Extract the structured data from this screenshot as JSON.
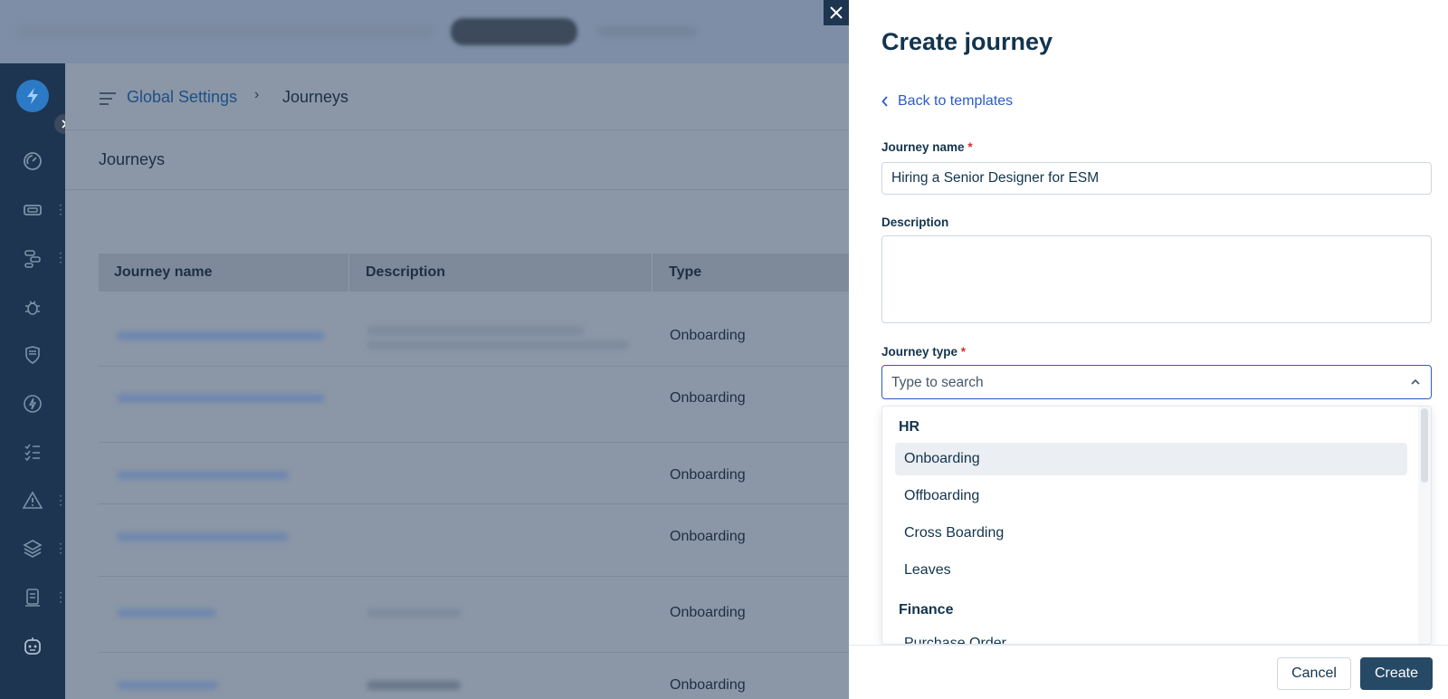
{
  "background": {
    "breadcrumb": {
      "link": "Global Settings",
      "separator": "›",
      "current": "Journeys"
    },
    "page_title": "Journeys",
    "table": {
      "columns": [
        "Journey name",
        "Description",
        "Type"
      ],
      "rows": [
        {
          "type": "Onboarding"
        },
        {
          "type": "Onboarding"
        },
        {
          "type": "Onboarding"
        },
        {
          "type": "Onboarding"
        },
        {
          "type": "Onboarding"
        },
        {
          "type": "Onboarding"
        }
      ]
    },
    "nav_icons": [
      "dashboard-icon",
      "ticket-icon",
      "workflow-icon",
      "bug-icon",
      "shield-icon",
      "bolt-icon",
      "checklist-icon",
      "alert-icon",
      "layers-icon",
      "document-icon",
      "bot-icon"
    ]
  },
  "drawer": {
    "title": "Create journey",
    "back_link": "Back to templates",
    "journey_name": {
      "label": "Journey name",
      "required": "*",
      "value": "Hiring a Senior Designer for ESM"
    },
    "description": {
      "label": "Description",
      "value": ""
    },
    "journey_type": {
      "label": "Journey type",
      "required": "*",
      "placeholder": "Type to search",
      "groups": [
        {
          "name": "HR",
          "options": [
            "Onboarding",
            "Offboarding",
            "Cross Boarding",
            "Leaves"
          ]
        },
        {
          "name": "Finance",
          "options": [
            "Purchase Order"
          ]
        }
      ],
      "hovered_option": "Onboarding"
    },
    "footer": {
      "cancel": "Cancel",
      "create": "Create"
    }
  },
  "colors": {
    "accent": "#2c5cc5",
    "primary_button": "#264966",
    "required": "#d72d30",
    "sidebar": "#1d3550"
  }
}
